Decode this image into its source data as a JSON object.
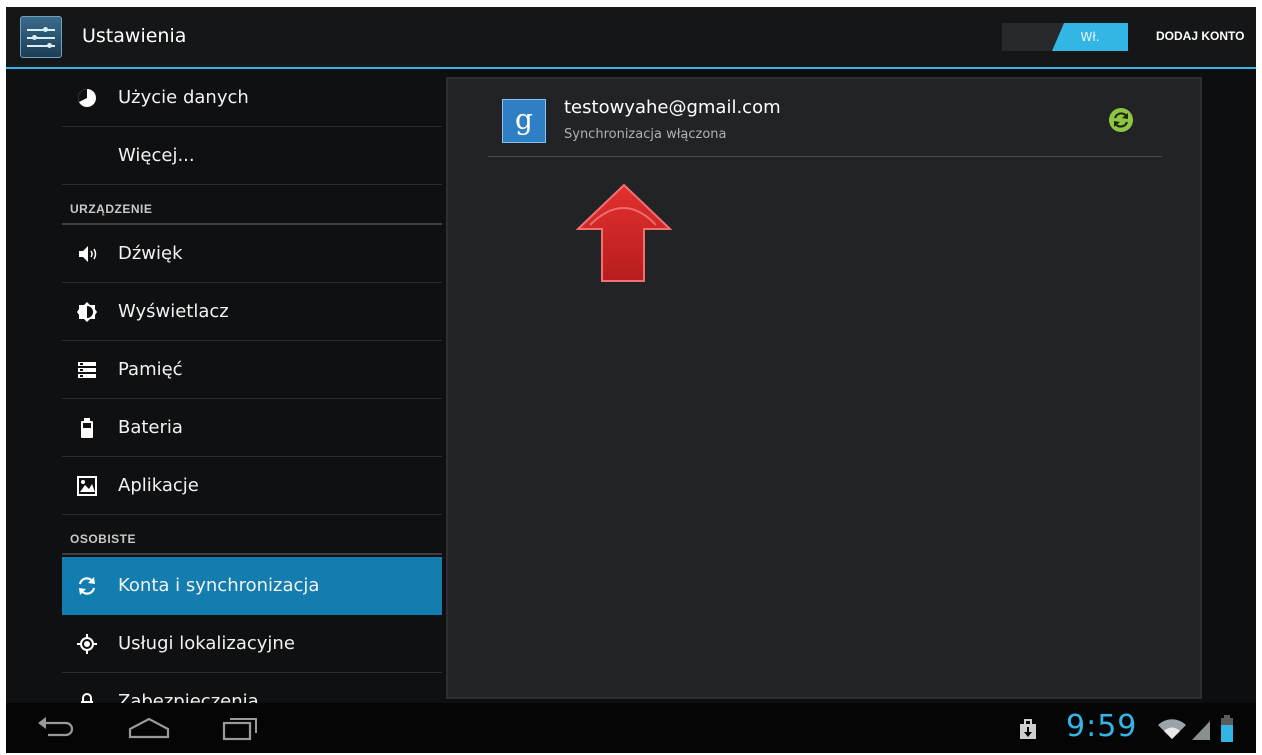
{
  "app": {
    "title": "Ustawienia",
    "icon": "settings-sliders-icon"
  },
  "actionbar": {
    "toggle": {
      "state": "on",
      "on_label": "Wł."
    },
    "add_account_label": "DODAJ KONTO"
  },
  "sidebar": {
    "items_top": [
      {
        "label": "Użycie danych",
        "icon": "data-usage-icon"
      },
      {
        "label": "Więcej...",
        "icon": ""
      }
    ],
    "section_device": "URZĄDZENIE",
    "items_device": [
      {
        "label": "Dźwięk",
        "icon": "sound-icon"
      },
      {
        "label": "Wyświetlacz",
        "icon": "display-icon"
      },
      {
        "label": "Pamięć",
        "icon": "storage-icon"
      },
      {
        "label": "Bateria",
        "icon": "battery-icon"
      },
      {
        "label": "Aplikacje",
        "icon": "apps-icon"
      }
    ],
    "section_personal": "OSOBISTE",
    "items_personal": [
      {
        "label": "Konta i synchronizacja",
        "icon": "sync-icon",
        "selected": true
      },
      {
        "label": "Usługi lokalizacyjne",
        "icon": "location-icon"
      },
      {
        "label": "Zabezpieczenia",
        "icon": "lock-icon"
      }
    ]
  },
  "account": {
    "email": "testowyahe@gmail.com",
    "status": "Synchronizacja włączona",
    "provider_glyph": "g",
    "provider_icon": "google-icon",
    "sync_icon": "sync-ok-icon"
  },
  "annotation": {
    "icon": "red-arrow-up-icon",
    "color": "#d42727"
  },
  "statusbar": {
    "time": "9:59"
  },
  "colors": {
    "accent": "#33b5e5",
    "selected": "#137db0",
    "sync_ok": "#8ec63f"
  }
}
